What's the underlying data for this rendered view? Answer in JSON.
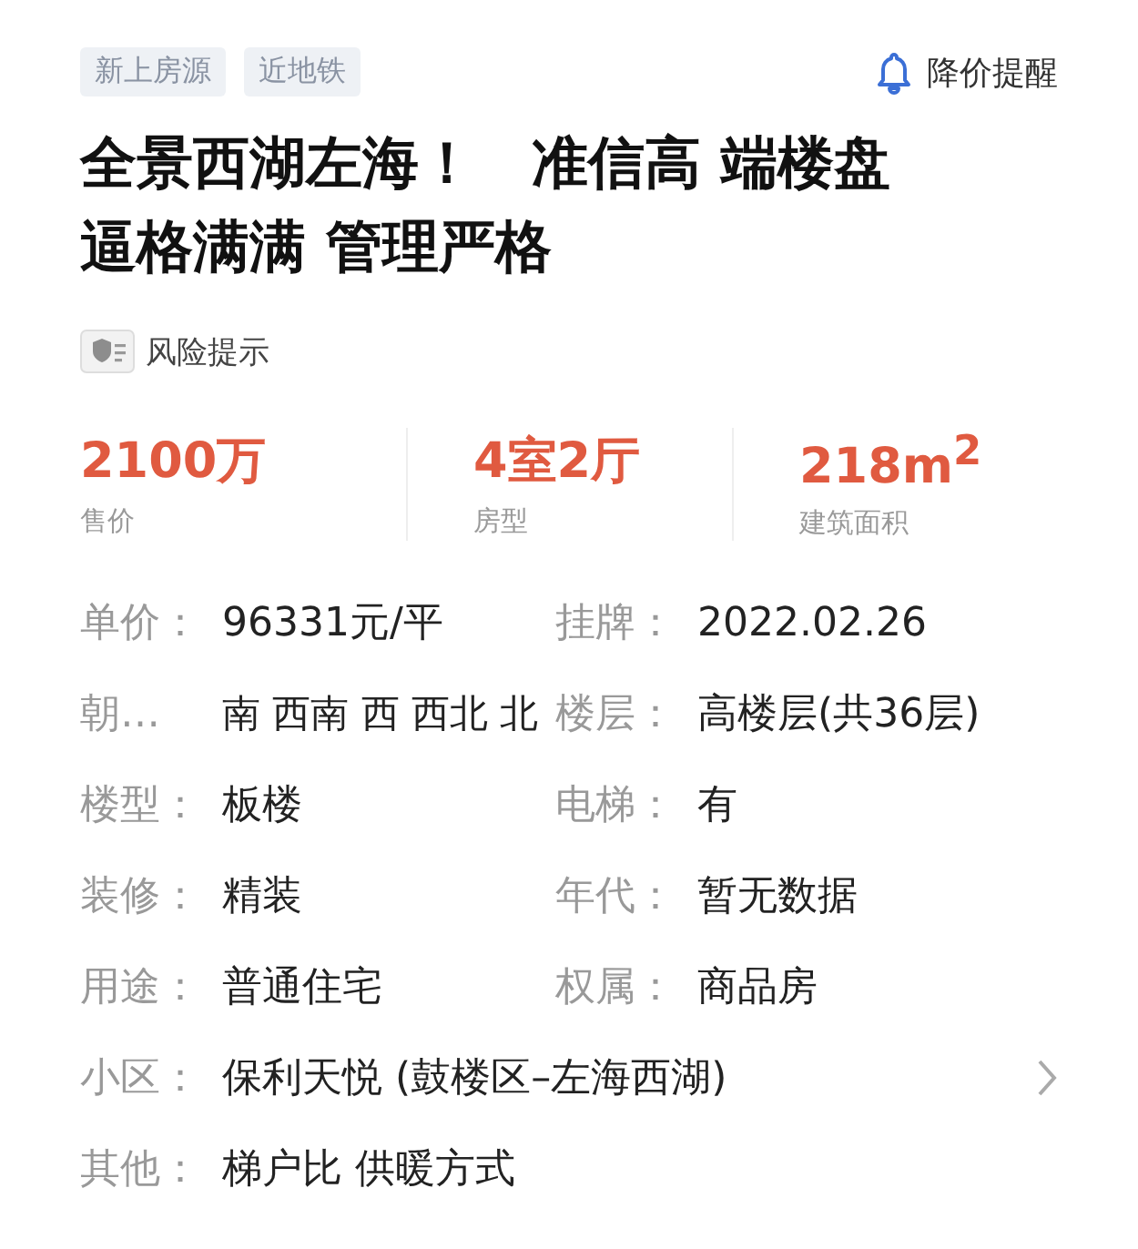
{
  "tags": [
    "新上房源",
    "近地铁"
  ],
  "price_alert": {
    "label": "降价提醒"
  },
  "title": "全景西湖左海！　准信高 端楼盘逼格满满 管理严格",
  "risk": {
    "label": "风险提示"
  },
  "stats": [
    {
      "value": "2100万",
      "label": "售价"
    },
    {
      "value": "4室2厅",
      "label": "房型"
    },
    {
      "value": "218m$^{2}$",
      "label": "建筑面积"
    }
  ],
  "details": [
    {
      "kind": "pair",
      "items": [
        {
          "label": "单价：",
          "value": "96331元/平"
        },
        {
          "label": "挂牌：",
          "value": "2022.02.26"
        }
      ]
    },
    {
      "kind": "pair",
      "items": [
        {
          "label": "朝…",
          "value": "南 西南 西 西北 北"
        },
        {
          "label": "楼层：",
          "value": "高楼层(共36层)"
        }
      ]
    },
    {
      "kind": "pair",
      "items": [
        {
          "label": "楼型：",
          "value": "板楼"
        },
        {
          "label": "电梯：",
          "value": "有"
        }
      ]
    },
    {
      "kind": "pair",
      "items": [
        {
          "label": "装修：",
          "value": "精装"
        },
        {
          "label": "年代：",
          "value": "暂无数据"
        }
      ]
    },
    {
      "kind": "pair",
      "items": [
        {
          "label": "用途：",
          "value": "普通住宅"
        },
        {
          "label": "权属：",
          "value": "商品房"
        }
      ]
    },
    {
      "kind": "link",
      "label": "小区：",
      "value": "保利天悦 (鼓楼区–左海西湖)"
    },
    {
      "kind": "full",
      "label": "其他：",
      "value": "梯户比 供暖方式"
    }
  ]
}
